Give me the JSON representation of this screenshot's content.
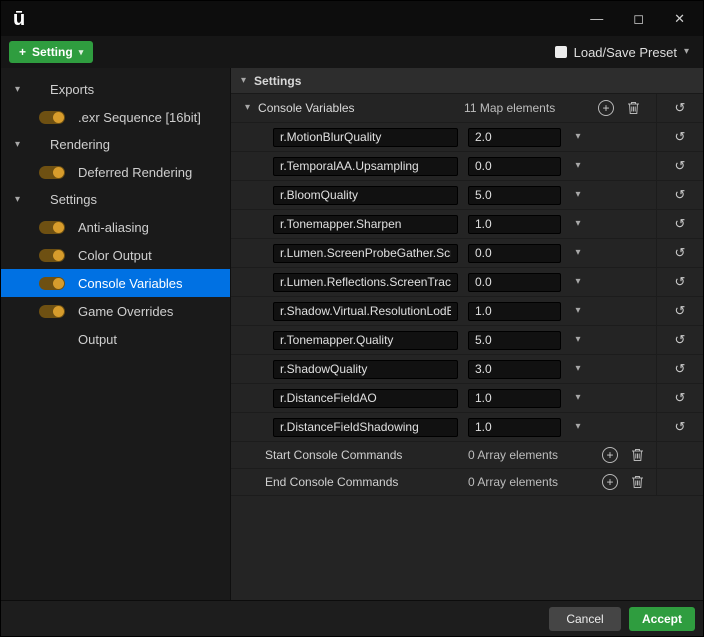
{
  "colors": {
    "accent_blue": "#0071e3",
    "button_green": "#2f9d3f",
    "toggle_gold": "#d79c2c"
  },
  "icons": {
    "plus": "+",
    "chevron_down": "▾",
    "reset": "↺"
  },
  "window": {
    "logo": "ū",
    "minimize": "—",
    "maximize": "◻",
    "close": "✕"
  },
  "toolbar": {
    "add_setting": "Setting",
    "load_save_preset": "Load/Save Preset"
  },
  "sidebar": {
    "groups": [
      {
        "label": "Exports",
        "items": [
          {
            "label": ".exr Sequence [16bit]"
          }
        ]
      },
      {
        "label": "Rendering",
        "items": [
          {
            "label": "Deferred Rendering"
          }
        ]
      },
      {
        "label": "Settings",
        "items": [
          {
            "label": "Anti-aliasing"
          },
          {
            "label": "Color Output"
          },
          {
            "label": "Console Variables"
          },
          {
            "label": "Game Overrides"
          },
          {
            "label": "Output"
          }
        ]
      }
    ]
  },
  "panel": {
    "header": "Settings",
    "console_variables": {
      "label": "Console Variables",
      "count": "11 Map elements",
      "rows": [
        {
          "name": "r.MotionBlurQuality",
          "value": "2.0"
        },
        {
          "name": "r.TemporalAA.Upsampling",
          "value": "0.0"
        },
        {
          "name": "r.BloomQuality",
          "value": "5.0"
        },
        {
          "name": "r.Tonemapper.Sharpen",
          "value": "1.0"
        },
        {
          "name": "r.Lumen.ScreenProbeGather.Scre",
          "value": "0.0"
        },
        {
          "name": "r.Lumen.Reflections.ScreenTrace",
          "value": "0.0"
        },
        {
          "name": "r.Shadow.Virtual.ResolutionLodBi",
          "value": "1.0"
        },
        {
          "name": "r.Tonemapper.Quality",
          "value": "5.0"
        },
        {
          "name": "r.ShadowQuality",
          "value": "3.0"
        },
        {
          "name": "r.DistanceFieldAO",
          "value": "1.0"
        },
        {
          "name": "r.DistanceFieldShadowing",
          "value": "1.0"
        }
      ]
    },
    "start_console_commands": {
      "label": "Start Console Commands",
      "count": "0 Array elements"
    },
    "end_console_commands": {
      "label": "End Console Commands",
      "count": "0 Array elements"
    }
  },
  "footer": {
    "cancel": "Cancel",
    "accept": "Accept"
  }
}
